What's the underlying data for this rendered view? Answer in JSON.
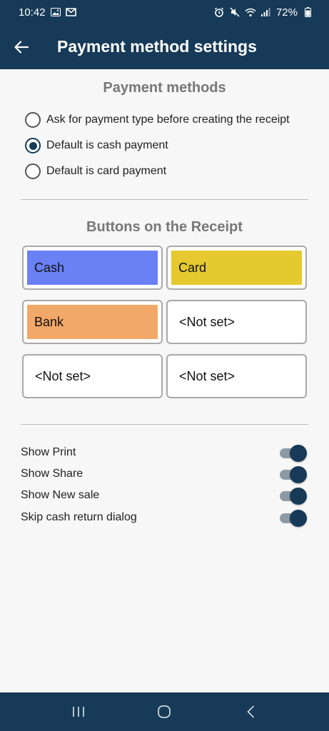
{
  "status_bar": {
    "time": "10:42",
    "battery": "72%"
  },
  "app_bar": {
    "title": "Payment method settings"
  },
  "payment_methods": {
    "title": "Payment methods",
    "options": [
      {
        "label": "Ask for payment type before creating the receipt",
        "selected": false
      },
      {
        "label": "Default is cash payment",
        "selected": true
      },
      {
        "label": "Default is card payment",
        "selected": false
      }
    ]
  },
  "receipt_buttons": {
    "title": "Buttons on the Receipt",
    "buttons": [
      {
        "label": "Cash",
        "color": "#6a80f5"
      },
      {
        "label": "Card",
        "color": "#e6c92e"
      },
      {
        "label": "Bank",
        "color": "#f2a868"
      },
      {
        "label": "<Not set>",
        "color": "#ffffff"
      },
      {
        "label": "<Not set>",
        "color": "#ffffff"
      },
      {
        "label": "<Not set>",
        "color": "#ffffff"
      }
    ]
  },
  "toggles": [
    {
      "label": "Show Print",
      "on": true
    },
    {
      "label": "Show Share",
      "on": true
    },
    {
      "label": "Show New sale",
      "on": true
    },
    {
      "label": "Skip cash return dialog",
      "on": true
    }
  ],
  "colors": {
    "primary": "#163a57",
    "section_title": "#777777"
  }
}
